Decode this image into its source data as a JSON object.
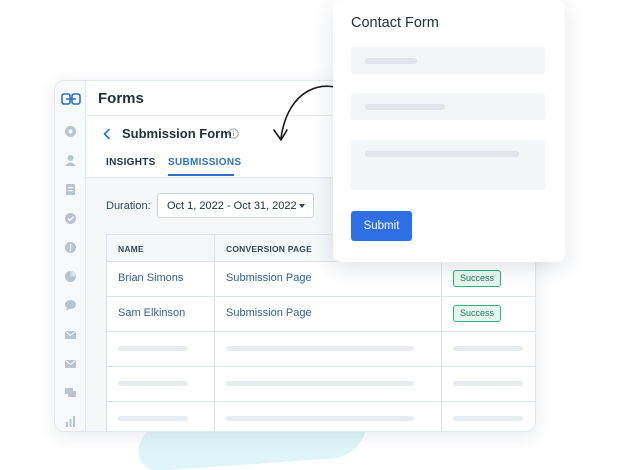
{
  "app": {
    "title": "Forms",
    "form_name": "Submission Form",
    "tabs": [
      {
        "label": "INSIGHTS",
        "active": false
      },
      {
        "label": "SUBMISSIONS",
        "active": true
      }
    ],
    "duration": {
      "label": "Duration:",
      "value": "Oct 1, 2022 - Oct 31, 2022"
    },
    "table": {
      "columns": [
        "NAME",
        "CONVERSION PAGE"
      ],
      "rows": [
        {
          "name": "Brian Simons",
          "page": "Submission Page",
          "status": "Success"
        },
        {
          "name": "Sam Elkinson",
          "page": "Submission Page",
          "status": "Success"
        }
      ]
    }
  },
  "contact_form": {
    "title": "Contact Form",
    "submit_label": "Submit"
  },
  "colors": {
    "accent": "#2d6fc9",
    "submit": "#2e6fe6",
    "success": "#31b078"
  }
}
